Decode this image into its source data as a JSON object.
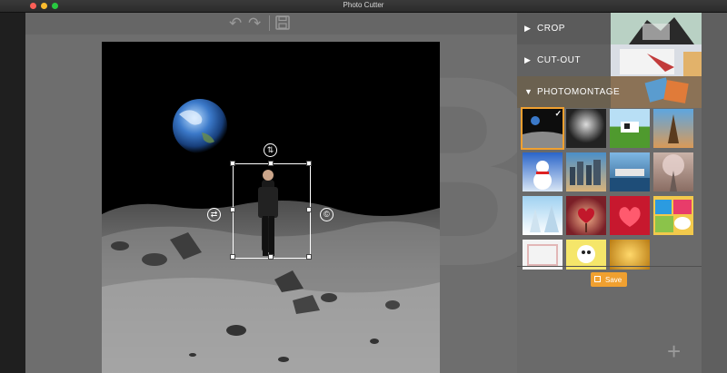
{
  "window": {
    "title": "Photo Cutter"
  },
  "toolbar": {
    "undo_icon": "undo-icon",
    "redo_icon": "redo-icon",
    "save_icon": "floppy-disk-icon"
  },
  "watermark": {
    "glyph": "B"
  },
  "sidebar": {
    "sections": [
      {
        "label": "CROP",
        "expanded": false
      },
      {
        "label": "CUT-OUT",
        "expanded": false
      },
      {
        "label": "PHOTOMONTAGE",
        "expanded": true
      }
    ],
    "templates": [
      {
        "name": "moon-landscape",
        "selected": true
      },
      {
        "name": "dark-stage",
        "selected": false
      },
      {
        "name": "cow-meadow",
        "selected": false
      },
      {
        "name": "eiffel-tower",
        "selected": false
      },
      {
        "name": "snowman",
        "selected": false
      },
      {
        "name": "city-skyline",
        "selected": false
      },
      {
        "name": "harbor-city",
        "selected": false
      },
      {
        "name": "tree-road",
        "selected": false
      },
      {
        "name": "winter-forest",
        "selected": false
      },
      {
        "name": "heart-tree",
        "selected": false
      },
      {
        "name": "red-heart",
        "selected": false
      },
      {
        "name": "comic-bubbles",
        "selected": false
      },
      {
        "name": "white-frame",
        "selected": false
      },
      {
        "name": "cartoon-sheep",
        "selected": false
      },
      {
        "name": "golden-sparkles",
        "selected": false
      }
    ],
    "add_label": "+",
    "save_label": "Save"
  },
  "colors": {
    "accent": "#f0a030",
    "panel": "#6a6a6a",
    "editor": "#6e6e6e"
  }
}
